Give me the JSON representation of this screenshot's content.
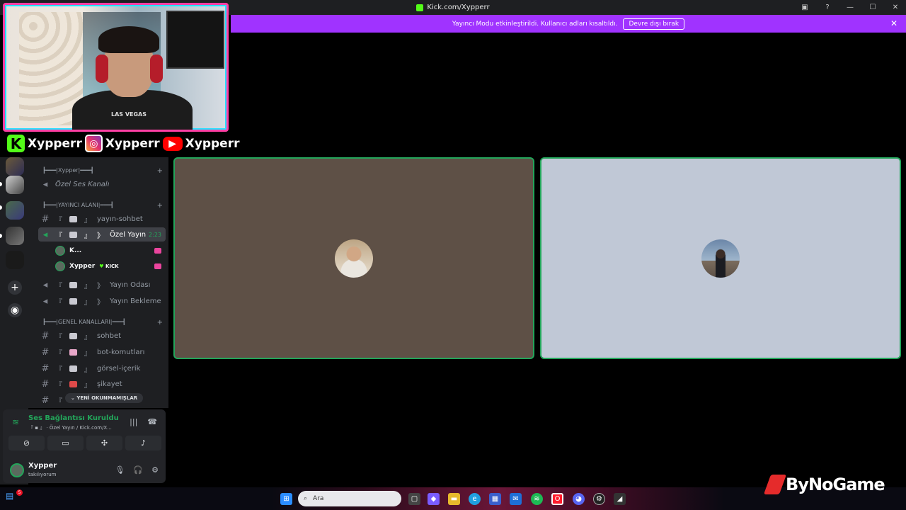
{
  "window": {
    "title": "Kick.com/Xypperr",
    "controls": {
      "minimize": "—",
      "maximize": "☐",
      "close": "✕"
    }
  },
  "banner": {
    "message": "Yayıncı Modu etkinleştirildi. Kullanıcı adları kısaltıldı.",
    "button": "Devre dışı bırak",
    "close": "✕"
  },
  "overlay": {
    "webcam_shirt": "LAS VEGAS",
    "socials": [
      {
        "platform": "kick",
        "handle": "Xypperr",
        "icon": "kick-icon"
      },
      {
        "platform": "instagram",
        "handle": "Xypperr",
        "icon": "instagram-icon"
      },
      {
        "platform": "youtube",
        "handle": "Xypperr",
        "icon": "youtube-icon"
      }
    ]
  },
  "sidebar": {
    "categories": [
      {
        "label": "┣━━━|Xypper|━━━┫"
      },
      {
        "label": "┣━━━|YAYINCI ALANI|━━━┫"
      },
      {
        "label": "┣━━━|GENEL KANALLARI|━━━┫"
      }
    ],
    "channels": {
      "private_voice": "Özel Ses Kanalı",
      "stream_chat": "yayın-sohbet",
      "private_stream": "Özel Yayın",
      "private_stream_timer": "2:23",
      "stream_room": "Yayın Odası",
      "stream_waiting": "Yayın Bekleme",
      "chat": "sohbet",
      "bot_commands": "bot-komutları",
      "visual_content": "görsel-içerik",
      "complaint": "şikayet"
    },
    "bracket_open": "『",
    "bracket_close": "』",
    "bracket_close_alt": "》",
    "voice_users": [
      {
        "name": "K..."
      },
      {
        "name": "Xypper",
        "badge": "KICK"
      }
    ],
    "unread_pill": "YENİ OKUNMAMIŞLAR"
  },
  "voice_panel": {
    "status": "Ses Bağlantısı Kuruldu",
    "channel": "『 ▪ 』 · Özel Yayın / Kick.com/X..."
  },
  "user_panel": {
    "name": "Xypper",
    "status": "takılıyorum"
  },
  "taskbar": {
    "search_placeholder": "Ara",
    "notification_count": "5"
  },
  "watermark": "ByNoGame",
  "colors": {
    "banner": "#a033ff",
    "speaking_border": "#23a55a",
    "tile1_bg": "#5e5046",
    "tile2_bg": "#c0c8d6",
    "kick_green": "#53fc18",
    "webcam_border": "#ff3fa4"
  }
}
